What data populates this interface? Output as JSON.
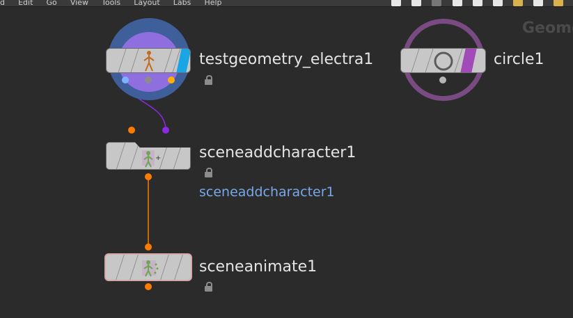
{
  "menubar": {
    "items": [
      "d",
      "Edit",
      "Go",
      "View",
      "Tools",
      "Layout",
      "Labs",
      "Help"
    ]
  },
  "network": {
    "context_label": "Geome",
    "nodes": [
      {
        "name": "testgeometry_electra1",
        "icon": "character-figure-icon",
        "flag_color": "#1aa6e5",
        "locked": true
      },
      {
        "name": "circle1",
        "icon": "circle-icon",
        "flag_color": "#a24ab8",
        "locked": false
      },
      {
        "name": "sceneaddcharacter1",
        "sublabel": "sceneaddcharacter1",
        "icon": "add-character-icon",
        "locked": true
      },
      {
        "name": "sceneanimate1",
        "icon": "animate-character-icon",
        "locked": true
      }
    ]
  },
  "colors": {
    "background": "#2b2b2b",
    "wire_orange": "#ff7b00",
    "wire_purple": "#8a2be2",
    "wire_blue": "#7fb2ff",
    "wire_yellow": "#ffb000",
    "ring_blue": "#3f5f9a",
    "ring_purple": "#8f6ee0",
    "ring_circle": "#7a4a83"
  }
}
